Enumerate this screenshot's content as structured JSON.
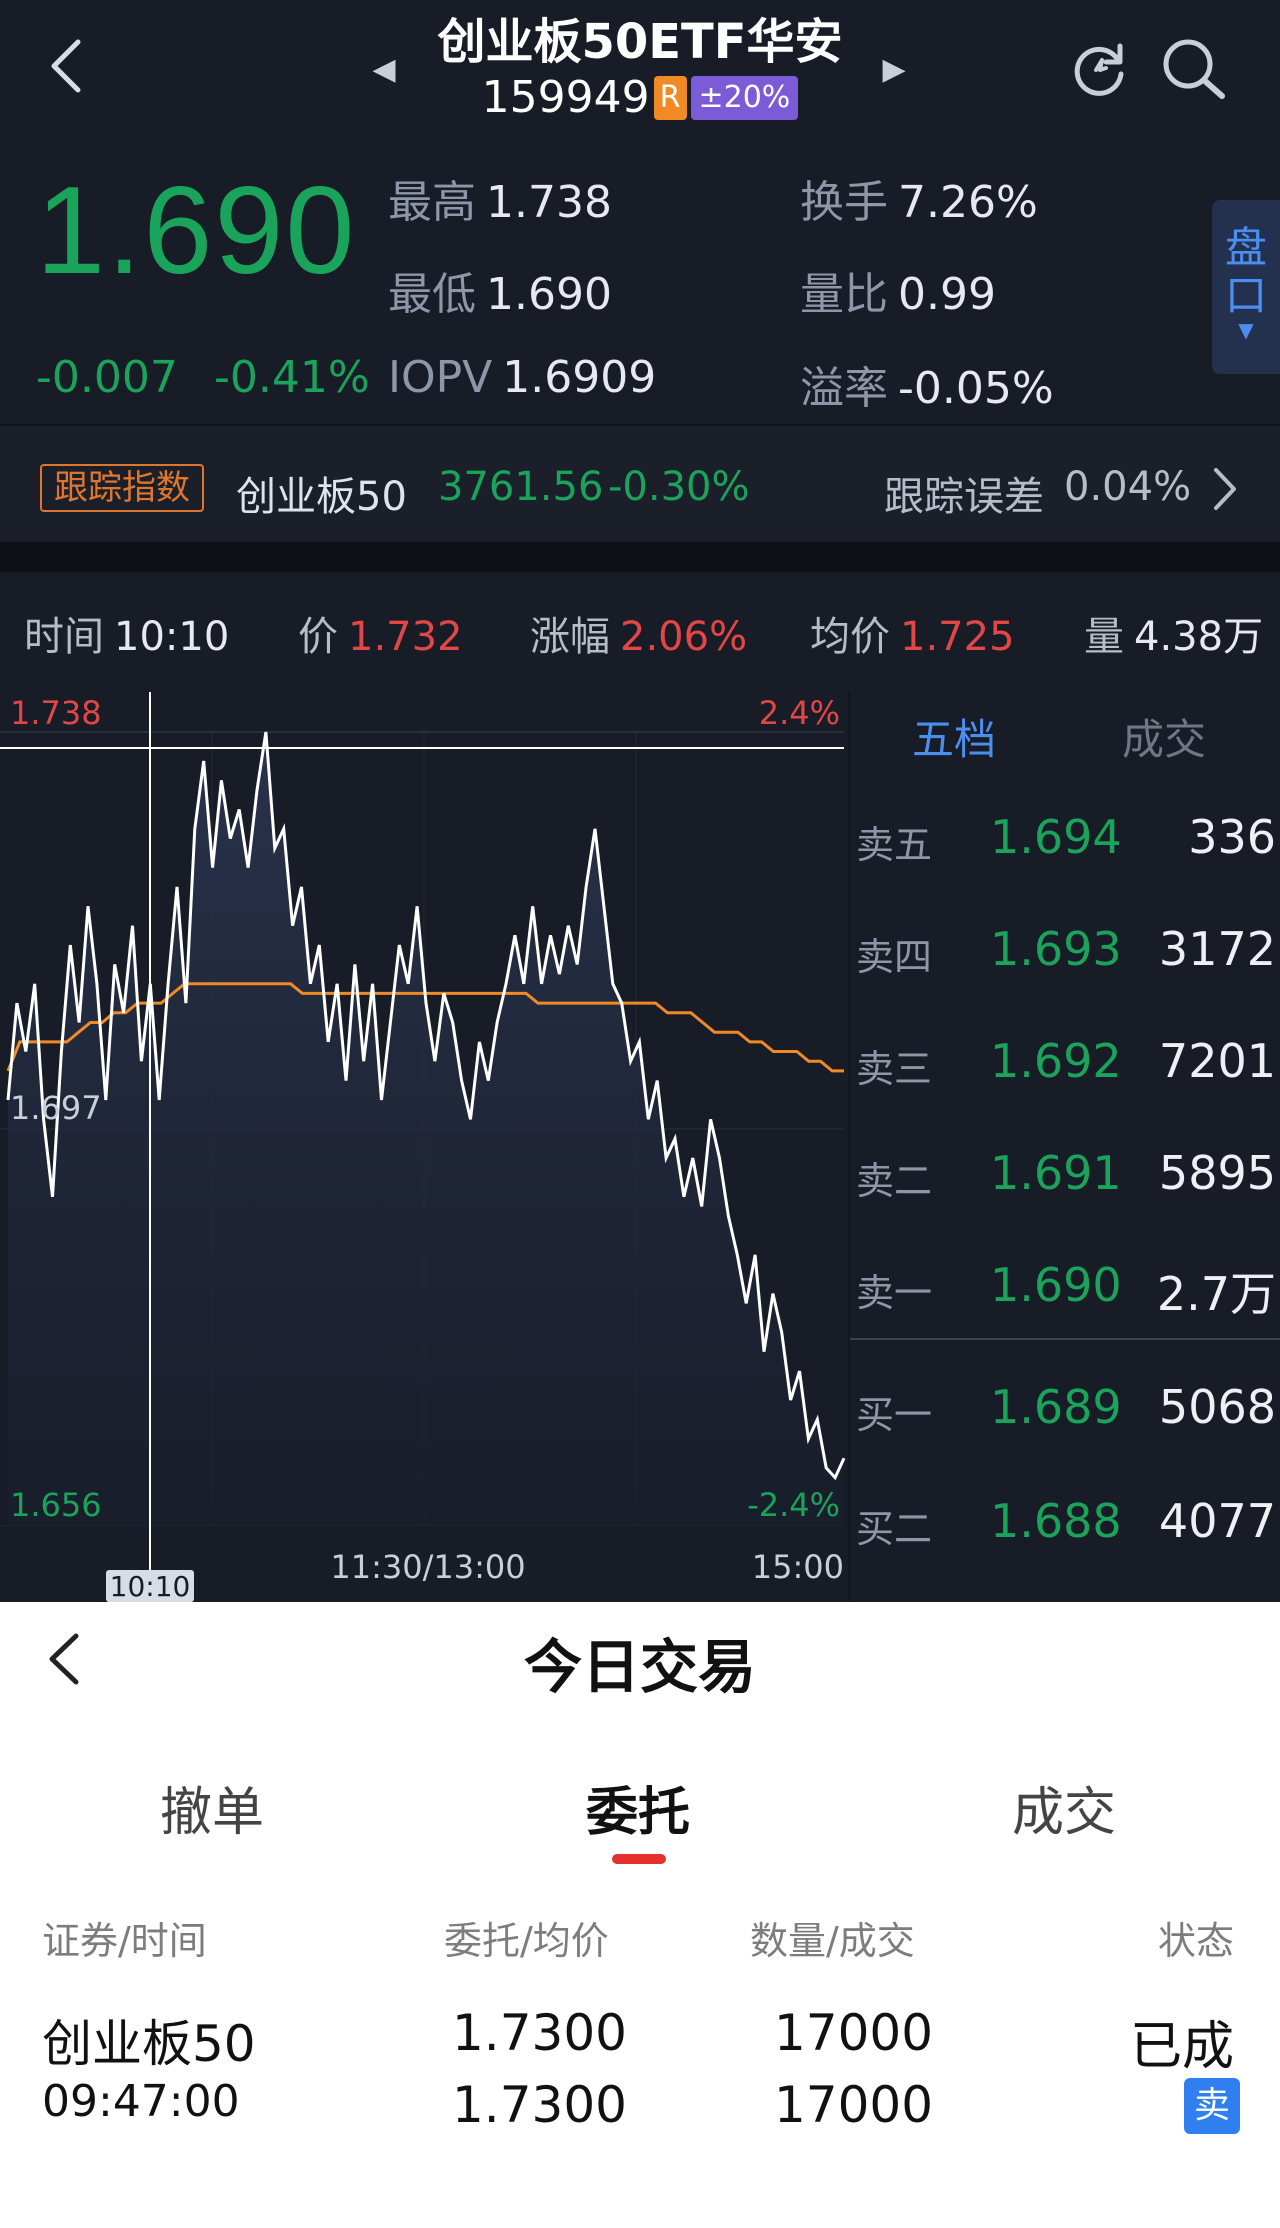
{
  "header": {
    "title": "创业板50ETF华安",
    "code": "159949",
    "badge_r": "R",
    "badge_limit": "±20%"
  },
  "quote": {
    "price": "1.690",
    "change": "-0.007",
    "change_pct": "-0.41%",
    "high_label": "最高",
    "high": "1.738",
    "low_label": "最低",
    "low": "1.690",
    "iopv_label": "IOPV",
    "iopv": "1.6909",
    "turnover_label": "换手",
    "turnover": "7.26%",
    "volume_ratio_label": "量比",
    "volume_ratio": "0.99",
    "premium_label": "溢率",
    "premium": "-0.05%",
    "pankou_label": "盘口"
  },
  "tracking": {
    "tag": "跟踪指数",
    "index_name": "创业板50",
    "index_value": "3761.56",
    "index_change_pct": "-0.30%",
    "error_label": "跟踪误差",
    "error_value": "0.04%"
  },
  "cursor_info": {
    "time_label": "时间",
    "time": "10:10",
    "price_label": "价",
    "price": "1.732",
    "change_label": "涨幅",
    "change": "2.06%",
    "avg_label": "均价",
    "avg": "1.725",
    "vol_label": "量",
    "vol": "4.38万"
  },
  "chart_data": {
    "type": "line",
    "y_labels": {
      "top": "1.738",
      "mid": "1.697",
      "bottom": "1.656"
    },
    "pct_labels": {
      "top": "2.4%",
      "bottom": "-2.4%"
    },
    "x_labels": [
      "10:10",
      "11:30/13:00",
      "15:00"
    ],
    "ylim": [
      1.656,
      1.738
    ],
    "series": [
      {
        "values": [
          1.7,
          1.71,
          1.705,
          1.712,
          1.698,
          1.69,
          1.705,
          1.716,
          1.708,
          1.72,
          1.712,
          1.7,
          1.714,
          1.709,
          1.718,
          1.704,
          1.712,
          1.7,
          1.712,
          1.722,
          1.71,
          1.728,
          1.735,
          1.724,
          1.733,
          1.727,
          1.73,
          1.724,
          1.732,
          1.738,
          1.726,
          1.728,
          1.718,
          1.722,
          1.712,
          1.716,
          1.706,
          1.712,
          1.702,
          1.714,
          1.704,
          1.712,
          1.7,
          1.708,
          1.716,
          1.712,
          1.72,
          1.71,
          1.704,
          1.711,
          1.708,
          1.702,
          1.698,
          1.706,
          1.702,
          1.708,
          1.712,
          1.717,
          1.712,
          1.72,
          1.712,
          1.717,
          1.713,
          1.718,
          1.714,
          1.722,
          1.728,
          1.72,
          1.712,
          1.71,
          1.704,
          1.706,
          1.698,
          1.702,
          1.694,
          1.696,
          1.69,
          1.694,
          1.689,
          1.698,
          1.694,
          1.688,
          1.684,
          1.679,
          1.684,
          1.674,
          1.68,
          1.676,
          1.669,
          1.672,
          1.665,
          1.667,
          1.662,
          1.661,
          1.663
        ],
        "color": "#ffffff"
      },
      {
        "values": [
          1.703,
          1.706,
          1.706,
          1.706,
          1.706,
          1.706,
          1.707,
          1.708,
          1.708,
          1.709,
          1.709,
          1.71,
          1.71,
          1.71,
          1.711,
          1.712,
          1.712,
          1.712,
          1.712,
          1.712,
          1.712,
          1.712,
          1.712,
          1.712,
          1.712,
          1.711,
          1.711,
          1.711,
          1.711,
          1.711,
          1.711,
          1.711,
          1.711,
          1.711,
          1.711,
          1.711,
          1.711,
          1.711,
          1.711,
          1.711,
          1.711,
          1.711,
          1.711,
          1.711,
          1.711,
          1.71,
          1.71,
          1.71,
          1.71,
          1.71,
          1.71,
          1.71,
          1.71,
          1.71,
          1.71,
          1.71,
          1.709,
          1.709,
          1.709,
          1.708,
          1.707,
          1.707,
          1.707,
          1.706,
          1.706,
          1.705,
          1.705,
          1.705,
          1.704,
          1.704,
          1.703,
          1.703
        ],
        "color": "#f08a24"
      }
    ]
  },
  "orderbook": {
    "tab_active": "五档",
    "tab_other": "成交",
    "asks": [
      {
        "label": "卖五",
        "price": "1.694",
        "qty": "336"
      },
      {
        "label": "卖四",
        "price": "1.693",
        "qty": "3172"
      },
      {
        "label": "卖三",
        "price": "1.692",
        "qty": "7201"
      },
      {
        "label": "卖二",
        "price": "1.691",
        "qty": "5895"
      },
      {
        "label": "卖一",
        "price": "1.690",
        "qty": "2.7万"
      }
    ],
    "bids": [
      {
        "label": "买一",
        "price": "1.689",
        "qty": "5068"
      },
      {
        "label": "买二",
        "price": "1.688",
        "qty": "4077"
      }
    ]
  },
  "trade": {
    "title": "今日交易",
    "tabs": [
      "撤单",
      "委托",
      "成交"
    ],
    "columns": [
      "证券/时间",
      "委托/均价",
      "数量/成交",
      "状态"
    ],
    "rows": [
      {
        "name": "创业板50",
        "time": "09:47:00",
        "order_price": "1.7300",
        "avg_price": "1.7300",
        "qty": "17000",
        "filled": "17000",
        "status": "已成",
        "side": "卖"
      }
    ]
  },
  "colors": {
    "down": "#1aa35b",
    "up": "#e24646",
    "avg_line": "#f08a24",
    "accent": "#e5312e",
    "sell_badge": "#2f7ff0"
  }
}
